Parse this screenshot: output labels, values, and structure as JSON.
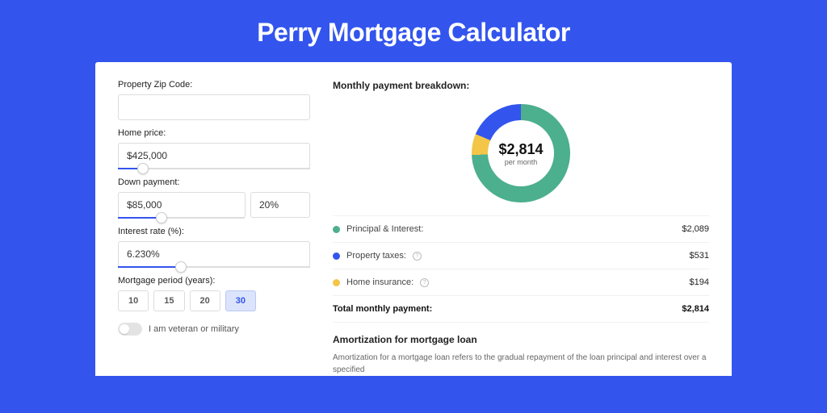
{
  "title": "Perry Mortgage Calculator",
  "form": {
    "zip_label": "Property Zip Code:",
    "zip_value": "",
    "price_label": "Home price:",
    "price_value": "$425,000",
    "down_label": "Down payment:",
    "down_value": "$85,000",
    "down_pct": "20%",
    "rate_label": "Interest rate (%):",
    "rate_value": "6.230%",
    "period_label": "Mortgage period (years):",
    "periods": [
      "10",
      "15",
      "20",
      "30"
    ],
    "period_active": "30",
    "veteran_label": "I am veteran or military"
  },
  "breakdown": {
    "title": "Monthly payment breakdown:",
    "center_value": "$2,814",
    "center_sub": "per month",
    "items": [
      {
        "label": "Principal & Interest:",
        "value": "$2,089",
        "color": "#4caf8e",
        "info": false
      },
      {
        "label": "Property taxes:",
        "value": "$531",
        "color": "#3355ee",
        "info": true
      },
      {
        "label": "Home insurance:",
        "value": "$194",
        "color": "#f3c648",
        "info": true
      }
    ],
    "total_label": "Total monthly payment:",
    "total_value": "$2,814"
  },
  "amort": {
    "title": "Amortization for mortgage loan",
    "text": "Amortization for a mortgage loan refers to the gradual repayment of the loan principal and interest over a specified"
  },
  "chart_data": {
    "type": "pie",
    "title": "Monthly payment breakdown",
    "series": [
      {
        "name": "Principal & Interest",
        "value": 2089,
        "color": "#4caf8e"
      },
      {
        "name": "Property taxes",
        "value": 531,
        "color": "#3355ee"
      },
      {
        "name": "Home insurance",
        "value": 194,
        "color": "#f3c648"
      }
    ],
    "total": 2814,
    "unit": "USD per month"
  }
}
